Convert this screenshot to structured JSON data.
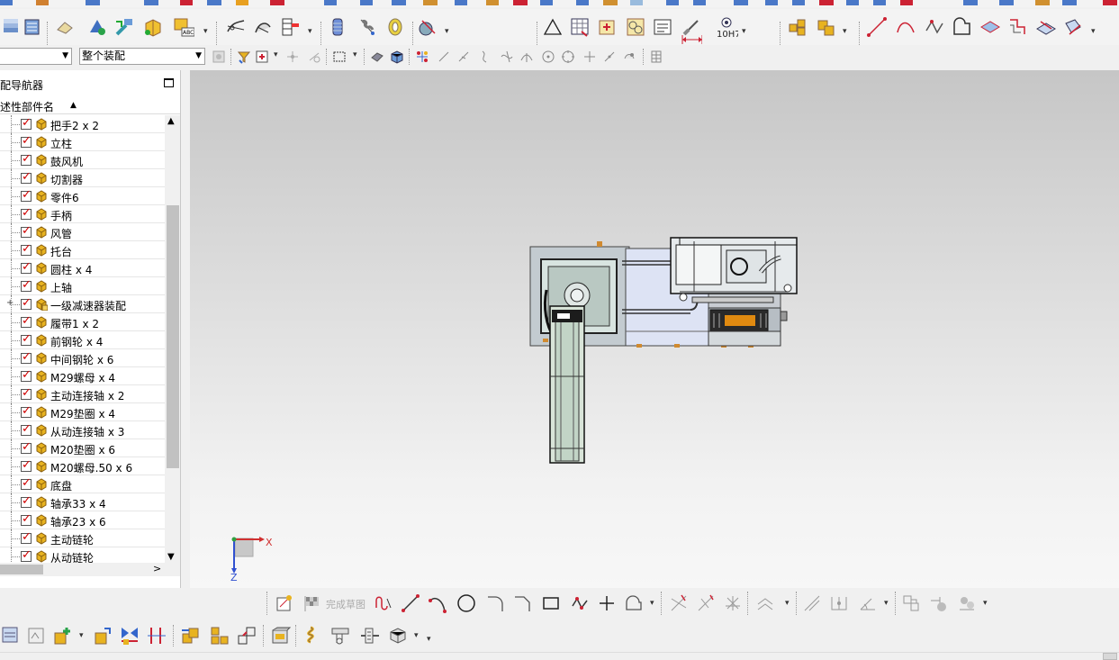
{
  "app": {
    "accent_red": "#d00000",
    "part_icon_color": "#e8b320"
  },
  "toolbar_row1": {
    "groups": [
      "assembly-tools",
      "feature-tools",
      "drafting-tools",
      "curve-tools"
    ],
    "text_icons": {
      "fit_tolerance": "10H7"
    }
  },
  "toolbar_row2": {
    "filter_combo": {
      "value": ""
    },
    "scope_combo": {
      "value": "整个装配"
    }
  },
  "navigator": {
    "title": "配导航器",
    "column_header": "述性部件名",
    "items": [
      {
        "label": "把手2 x 2",
        "checked": true,
        "expandable": false
      },
      {
        "label": "立柱",
        "checked": true,
        "expandable": false
      },
      {
        "label": "鼓风机",
        "checked": true,
        "expandable": false
      },
      {
        "label": "切割器",
        "checked": true,
        "expandable": false
      },
      {
        "label": "零件6",
        "checked": true,
        "expandable": false
      },
      {
        "label": "手柄",
        "checked": true,
        "expandable": false
      },
      {
        "label": "风管",
        "checked": true,
        "expandable": false
      },
      {
        "label": "托台",
        "checked": true,
        "expandable": false
      },
      {
        "label": "圆柱 x 4",
        "checked": true,
        "expandable": false
      },
      {
        "label": "上轴",
        "checked": true,
        "expandable": false
      },
      {
        "label": "一级减速器装配",
        "checked": true,
        "expandable": true
      },
      {
        "label": "履带1 x 2",
        "checked": true,
        "expandable": false
      },
      {
        "label": "前钢轮 x 4",
        "checked": true,
        "expandable": false
      },
      {
        "label": "中间钢轮 x 6",
        "checked": true,
        "expandable": false
      },
      {
        "label": "M29螺母 x 4",
        "checked": true,
        "expandable": false
      },
      {
        "label": "主动连接轴 x 2",
        "checked": true,
        "expandable": false
      },
      {
        "label": "M29垫圈 x 4",
        "checked": true,
        "expandable": false
      },
      {
        "label": "从动连接轴 x 3",
        "checked": true,
        "expandable": false
      },
      {
        "label": "M20垫圈 x 6",
        "checked": true,
        "expandable": false
      },
      {
        "label": "M20螺母.50 x 6",
        "checked": true,
        "expandable": false
      },
      {
        "label": "底盘",
        "checked": true,
        "expandable": false
      },
      {
        "label": "轴承33 x 4",
        "checked": true,
        "expandable": false
      },
      {
        "label": "轴承23 x 6",
        "checked": true,
        "expandable": false
      },
      {
        "label": "主动链轮",
        "checked": true,
        "expandable": false
      },
      {
        "label": "从动链轮",
        "checked": true,
        "expandable": false
      }
    ]
  },
  "viewport": {
    "triad": {
      "x_label": "X",
      "z_label": "Z"
    }
  },
  "sketch_toolbar": {
    "finish_sketch_label": "完成草图"
  }
}
